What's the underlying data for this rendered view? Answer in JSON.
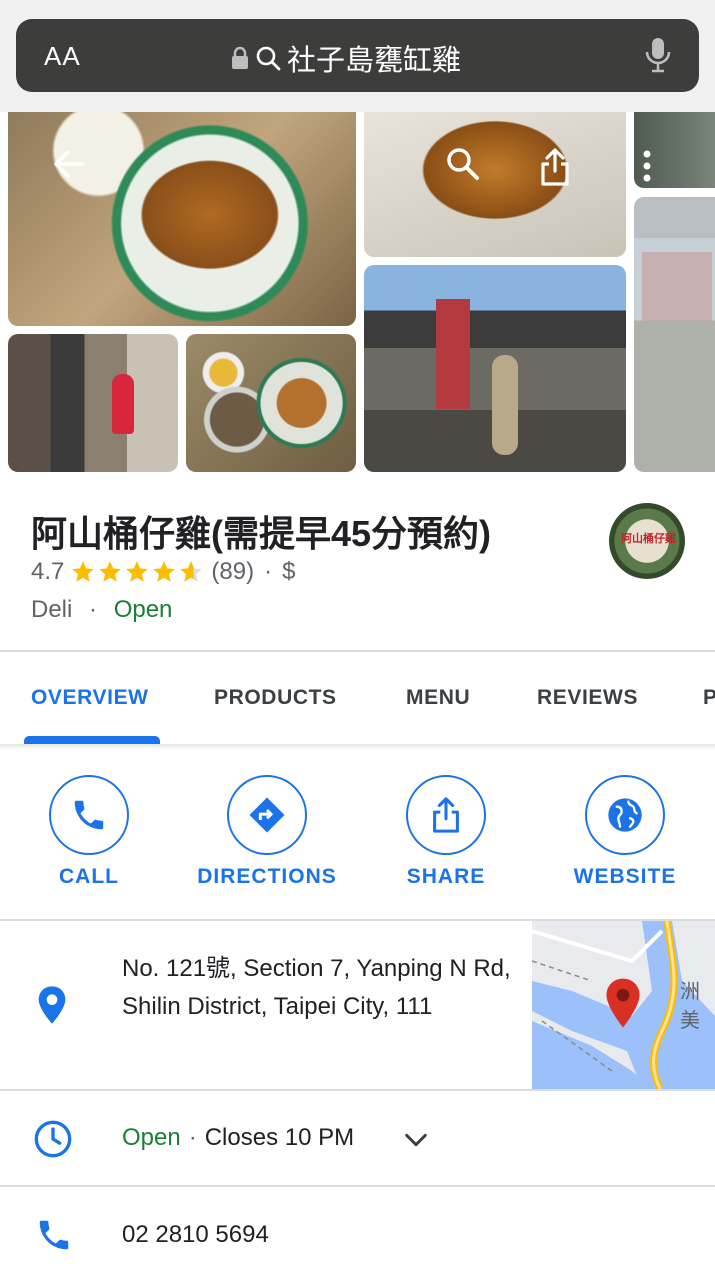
{
  "browser": {
    "aa_label": "AA",
    "url_text": "社子島甕缸雞",
    "icons": [
      "lock-icon",
      "search-icon",
      "mic-icon"
    ]
  },
  "photos": {
    "overlay_icons": [
      "back-arrow-icon",
      "search-icon",
      "share-icon",
      "more-vert-icon"
    ]
  },
  "place": {
    "title": "阿山桶仔雞(需提早45分預約)",
    "rating": "4.7",
    "stars": 4.7,
    "review_count": "(89)",
    "price": "$",
    "category": "Deli",
    "status": "Open",
    "dot": "·",
    "logo_text": "阿山桶仔雞"
  },
  "tabs": [
    {
      "label": "OVERVIEW",
      "active": true
    },
    {
      "label": "PRODUCTS",
      "active": false
    },
    {
      "label": "MENU",
      "active": false
    },
    {
      "label": "REVIEWS",
      "active": false
    },
    {
      "label": "P",
      "active": false
    }
  ],
  "actions": [
    {
      "label": "CALL",
      "icon": "phone-icon"
    },
    {
      "label": "DIRECTIONS",
      "icon": "directions-icon"
    },
    {
      "label": "SHARE",
      "icon": "share-icon"
    },
    {
      "label": "WEBSITE",
      "icon": "globe-icon"
    }
  ],
  "details": {
    "address": "No. 121號, Section 7, Yanping N Rd, Shilin District, Taipei City, 111",
    "hours_status": "Open",
    "hours_sep": "·",
    "hours_text": "Closes 10 PM",
    "phone": "02 2810 5694",
    "map_label": "洲美"
  },
  "colors": {
    "accent": "#1a73e8",
    "open_green": "#188038",
    "star": "#fbbc04",
    "pin_red": "#d93025"
  }
}
